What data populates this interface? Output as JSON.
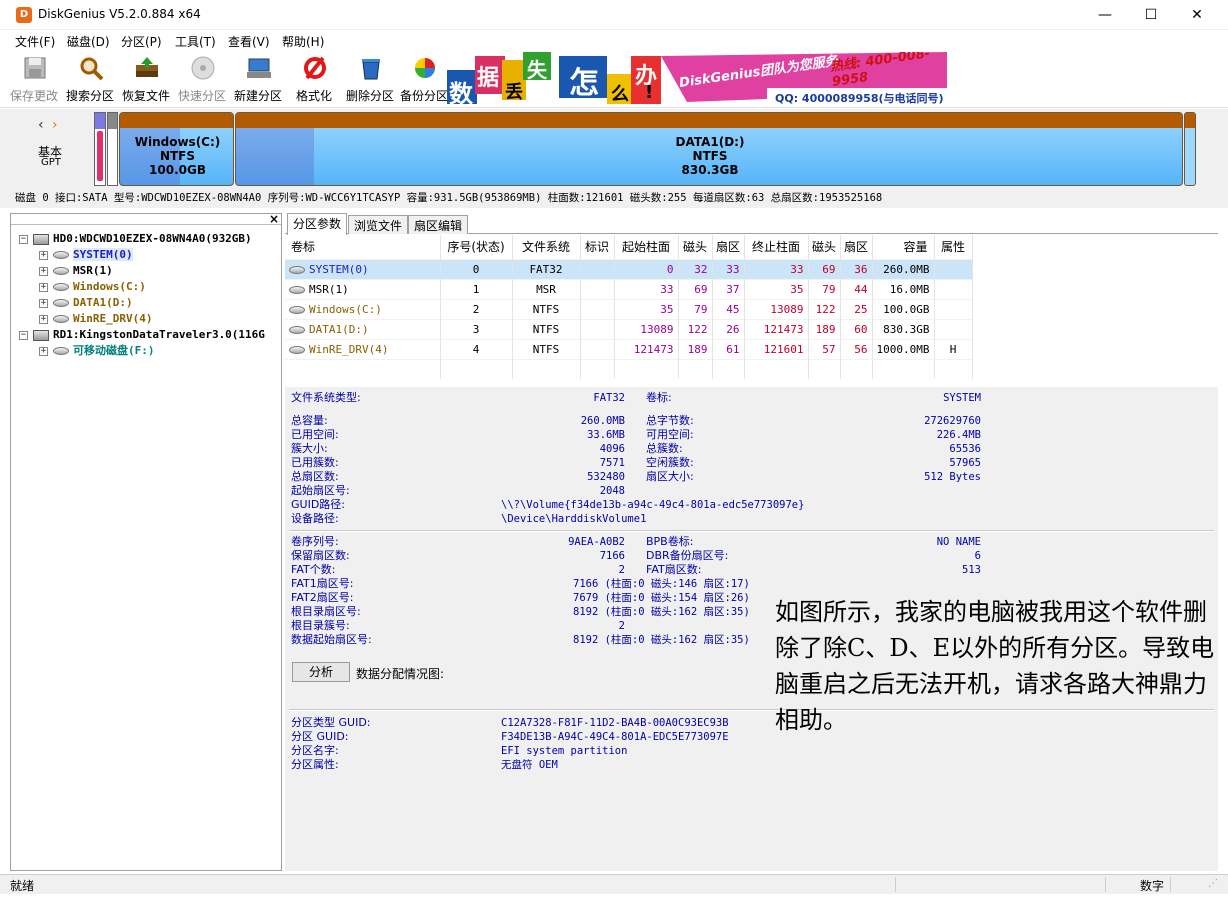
{
  "window": {
    "title": "DiskGenius V5.2.0.884 x64",
    "minimize": "—",
    "maximize": "☐",
    "close": "✕"
  },
  "menu": [
    "文件(F)",
    "磁盘(D)",
    "分区(P)",
    "工具(T)",
    "查看(V)",
    "帮助(H)"
  ],
  "toolbar": [
    {
      "label": "保存更改",
      "icon": "save-icon",
      "enabled": false
    },
    {
      "label": "搜索分区",
      "icon": "search-icon",
      "enabled": true
    },
    {
      "label": "恢复文件",
      "icon": "recover-icon",
      "enabled": true
    },
    {
      "label": "快速分区",
      "icon": "quick-partition-icon",
      "enabled": false
    },
    {
      "label": "新建分区",
      "icon": "new-partition-icon",
      "enabled": true
    },
    {
      "label": "格式化",
      "icon": "format-icon",
      "enabled": true
    },
    {
      "label": "删除分区",
      "icon": "delete-icon",
      "enabled": true
    },
    {
      "label": "备份分区",
      "icon": "backup-icon",
      "enabled": true
    }
  ],
  "banner": {
    "chars": [
      "数",
      "据",
      "丢",
      "失",
      "怎",
      "么",
      "办",
      "!"
    ],
    "brand": "DiskGenius团队为您服务",
    "phone": "热线: 400-008-9958",
    "qq": "QQ: 4000089958(与电话同号)"
  },
  "diskmap": {
    "disk_type": "基本",
    "disk_scheme": "GPT",
    "partitions": [
      {
        "name": "Windows(C:)",
        "fs": "NTFS",
        "size": "100.0GB"
      },
      {
        "name": "DATA1(D:)",
        "fs": "NTFS",
        "size": "830.3GB"
      }
    ]
  },
  "disk_info": "磁盘 0 接口:SATA  型号:WDCWD10EZEX-08WN4A0  序列号:WD-WCC6Y1TCASYP  容量:931.5GB(953869MB)  柱面数:121601  磁头数:255  每道扇区数:63  总扇区数:1953525168",
  "tree": {
    "close": "×",
    "disk0": "HD0:WDCWD10EZEX-08WN4A0(932GB)",
    "partitions": [
      "SYSTEM(0)",
      "MSR(1)",
      "Windows(C:)",
      "DATA1(D:)",
      "WinRE_DRV(4)"
    ],
    "disk1": "RD1:KingstonDataTraveler3.0(116G",
    "removable": "可移动磁盘(F:)"
  },
  "tabs": [
    "分区参数",
    "浏览文件",
    "扇区编辑"
  ],
  "table": {
    "headers": [
      "卷标",
      "序号(状态)",
      "文件系统",
      "标识",
      "起始柱面",
      "磁头",
      "扇区",
      "终止柱面",
      "磁头",
      "扇区",
      "容量",
      "属性"
    ],
    "rows": [
      [
        "SYSTEM(0)",
        "0",
        "FAT32",
        "",
        "0",
        "32",
        "33",
        "33",
        "69",
        "36",
        "260.0MB",
        ""
      ],
      [
        "MSR(1)",
        "1",
        "MSR",
        "",
        "33",
        "69",
        "37",
        "35",
        "79",
        "44",
        "16.0MB",
        ""
      ],
      [
        "Windows(C:)",
        "2",
        "NTFS",
        "",
        "35",
        "79",
        "45",
        "13089",
        "122",
        "25",
        "100.0GB",
        ""
      ],
      [
        "DATA1(D:)",
        "3",
        "NTFS",
        "",
        "13089",
        "122",
        "26",
        "121473",
        "189",
        "60",
        "830.3GB",
        ""
      ],
      [
        "WinRE_DRV(4)",
        "4",
        "NTFS",
        "",
        "121473",
        "189",
        "61",
        "121601",
        "57",
        "56",
        "1000.0MB",
        "H"
      ]
    ]
  },
  "details": {
    "fs_type_label": "文件系统类型:",
    "fs_type": "FAT32",
    "vol_label_label": "卷标:",
    "vol_label": "SYSTEM",
    "total_size_label": "总容量:",
    "total_size": "260.0MB",
    "total_bytes_label": "总字节数:",
    "total_bytes": "272629760",
    "used_label": "已用空间:",
    "used": "33.6MB",
    "free_label": "可用空间:",
    "free": "226.4MB",
    "cluster_size_label": "簇大小:",
    "cluster_size": "4096",
    "total_clusters_label": "总簇数:",
    "total_clusters": "65536",
    "used_clusters_label": "已用簇数:",
    "used_clusters": "7571",
    "free_clusters_label": "空闲簇数:",
    "free_clusters": "57965",
    "total_sectors_label": "总扇区数:",
    "total_sectors": "532480",
    "sector_size_label": "扇区大小:",
    "sector_size": "512 Bytes",
    "start_sector_label": "起始扇区号:",
    "start_sector": "2048",
    "guid_path_label": "GUID路径:",
    "guid_path": "\\\\?\\Volume{f34de13b-a94c-49c4-801a-edc5e773097e}",
    "device_path_label": "设备路径:",
    "device_path": "\\Device\\HarddiskVolume1",
    "serial_label": "卷序列号:",
    "serial": "9AEA-A0B2",
    "bpb_label": "BPB卷标:",
    "bpb": "NO NAME",
    "reserved_label": "保留扇区数:",
    "reserved": "7166",
    "dbr_label": "DBR备份扇区号:",
    "dbr": "6",
    "fat_count_label": "FAT个数:",
    "fat_count": "2",
    "fat_sectors_label": "FAT扇区数:",
    "fat_sectors": "513",
    "fat1_label": "FAT1扇区号:",
    "fat1": "7166 (柱面:0 磁头:146 扇区:17)",
    "fat2_label": "FAT2扇区号:",
    "fat2": "7679 (柱面:0 磁头:154 扇区:26)",
    "root_sector_label": "根目录扇区号:",
    "root_sector": "8192 (柱面:0 磁头:162 扇区:35)",
    "root_cluster_label": "根目录簇号:",
    "root_cluster": "2",
    "data_start_label": "数据起始扇区号:",
    "data_start": "8192 (柱面:0 磁头:162 扇区:35)",
    "analyze_button": "分析",
    "alloc_label": "数据分配情况图:",
    "ptype_guid_label": "分区类型 GUID:",
    "ptype_guid": "C12A7328-F81F-11D2-BA4B-00A0C93EC93B",
    "part_guid_label": "分区 GUID:",
    "part_guid": "F34DE13B-A94C-49C4-801A-EDC5E773097E",
    "part_name_label": "分区名字:",
    "part_name": "EFI system partition",
    "part_attr_label": "分区属性:",
    "part_attr": "无盘符 OEM"
  },
  "overlay_text": "如图所示，我家的电脑被我用这个软件删除了除C、D、E以外的所有分区。导致电脑重启之后无法开机，请求各路大神鼎力相助。",
  "status": {
    "left": "就绪",
    "numlock": "数字"
  },
  "colors": {
    "accent_orange": "#b45a00",
    "system_text": "#2020c0",
    "partition_text": "#8a6000",
    "detail_text": "#0000aa",
    "cyl_red": "#c0002a",
    "cyl_magenta": "#9a009a"
  }
}
